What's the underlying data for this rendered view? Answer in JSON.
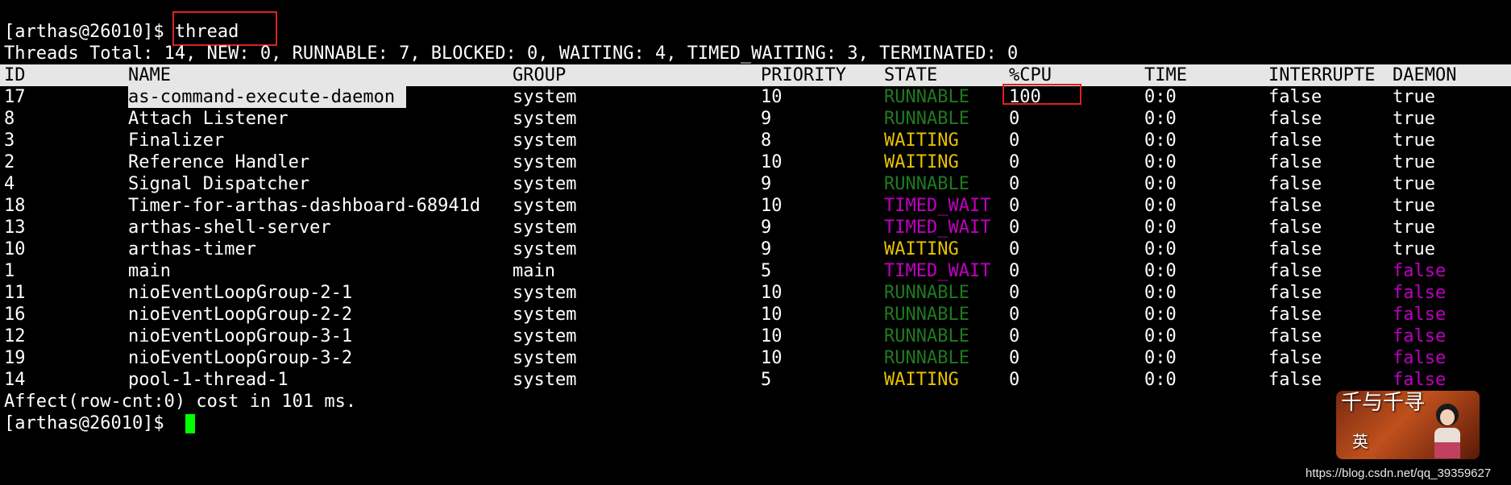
{
  "colors": {
    "background": "#000000",
    "foreground": "#ffffff",
    "runnable": "#1f7a1f",
    "waiting": "#e6c200",
    "timed_waiting": "#c000c0",
    "daemon_false": "#c000c0",
    "highlight_box": "#e02020",
    "cursor": "#00ff00",
    "header_bg": "#e6e6e6"
  },
  "terminal": {
    "prompt": "[arthas@26010]$ ",
    "command": "thread",
    "summary": "Threads Total: 14, NEW: 0, RUNNABLE: 7, BLOCKED: 0, WAITING: 4, TIMED_WAITING: 3, TERMINATED: 0",
    "columns": {
      "id": "ID",
      "name": "NAME",
      "group": "GROUP",
      "priority": "PRIORITY",
      "state": "STATE",
      "cpu": "%CPU",
      "time": "TIME",
      "interrupted": "INTERRUPTE",
      "daemon": "DAEMON"
    },
    "rows": [
      {
        "id": "17",
        "name": "as-command-execute-daemon",
        "group": "system",
        "priority": "10",
        "state": "RUNNABLE",
        "cpu": "100",
        "time": "0:0",
        "interrupted": "false",
        "daemon": "true"
      },
      {
        "id": "8",
        "name": "Attach Listener",
        "group": "system",
        "priority": "9",
        "state": "RUNNABLE",
        "cpu": "0",
        "time": "0:0",
        "interrupted": "false",
        "daemon": "true"
      },
      {
        "id": "3",
        "name": "Finalizer",
        "group": "system",
        "priority": "8",
        "state": "WAITING",
        "cpu": "0",
        "time": "0:0",
        "interrupted": "false",
        "daemon": "true"
      },
      {
        "id": "2",
        "name": "Reference Handler",
        "group": "system",
        "priority": "10",
        "state": "WAITING",
        "cpu": "0",
        "time": "0:0",
        "interrupted": "false",
        "daemon": "true"
      },
      {
        "id": "4",
        "name": "Signal Dispatcher",
        "group": "system",
        "priority": "9",
        "state": "RUNNABLE",
        "cpu": "0",
        "time": "0:0",
        "interrupted": "false",
        "daemon": "true"
      },
      {
        "id": "18",
        "name": "Timer-for-arthas-dashboard-68941d",
        "group": "system",
        "priority": "10",
        "state": "TIMED_WAIT",
        "cpu": "0",
        "time": "0:0",
        "interrupted": "false",
        "daemon": "true"
      },
      {
        "id": "13",
        "name": "arthas-shell-server",
        "group": "system",
        "priority": "9",
        "state": "TIMED_WAIT",
        "cpu": "0",
        "time": "0:0",
        "interrupted": "false",
        "daemon": "true"
      },
      {
        "id": "10",
        "name": "arthas-timer",
        "group": "system",
        "priority": "9",
        "state": "WAITING",
        "cpu": "0",
        "time": "0:0",
        "interrupted": "false",
        "daemon": "true"
      },
      {
        "id": "1",
        "name": "main",
        "group": "main",
        "priority": "5",
        "state": "TIMED_WAIT",
        "cpu": "0",
        "time": "0:0",
        "interrupted": "false",
        "daemon": "false"
      },
      {
        "id": "11",
        "name": "nioEventLoopGroup-2-1",
        "group": "system",
        "priority": "10",
        "state": "RUNNABLE",
        "cpu": "0",
        "time": "0:0",
        "interrupted": "false",
        "daemon": "false"
      },
      {
        "id": "16",
        "name": "nioEventLoopGroup-2-2",
        "group": "system",
        "priority": "10",
        "state": "RUNNABLE",
        "cpu": "0",
        "time": "0:0",
        "interrupted": "false",
        "daemon": "false"
      },
      {
        "id": "12",
        "name": "nioEventLoopGroup-3-1",
        "group": "system",
        "priority": "10",
        "state": "RUNNABLE",
        "cpu": "0",
        "time": "0:0",
        "interrupted": "false",
        "daemon": "false"
      },
      {
        "id": "19",
        "name": "nioEventLoopGroup-3-2",
        "group": "system",
        "priority": "10",
        "state": "RUNNABLE",
        "cpu": "0",
        "time": "0:0",
        "interrupted": "false",
        "daemon": "false"
      },
      {
        "id": "14",
        "name": "pool-1-thread-1",
        "group": "system",
        "priority": "5",
        "state": "WAITING",
        "cpu": "0",
        "time": "0:0",
        "interrupted": "false",
        "daemon": "false"
      }
    ],
    "footer": "Affect(row-cnt:0) cost in 101 ms.",
    "final_prompt": "[arthas@26010]$ "
  },
  "watermark": {
    "title": "千与千寻",
    "subtitle": "英",
    "url": "https://blog.csdn.net/qq_39359627"
  }
}
